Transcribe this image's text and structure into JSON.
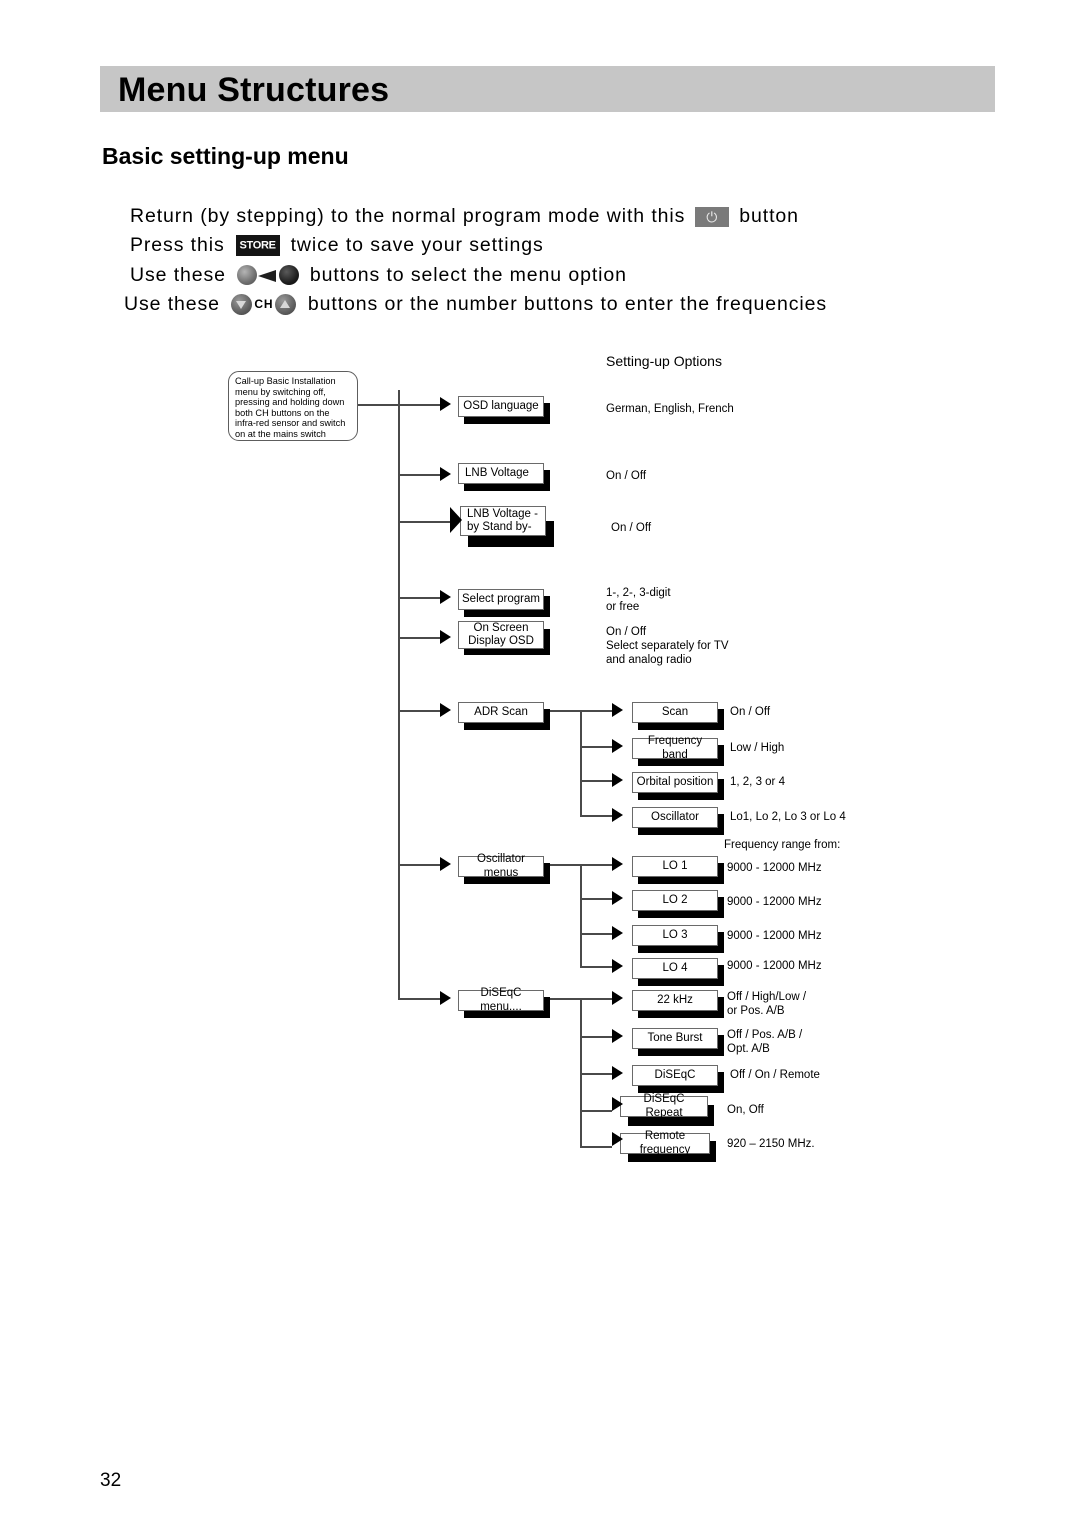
{
  "header": {
    "title": "Menu Structures"
  },
  "section": {
    "title": "Basic setting-up menu"
  },
  "instructions": [
    {
      "before": "Return (by stepping) to the normal program mode with this",
      "icon": "power-button-icon",
      "after": "button"
    },
    {
      "before": "Press this",
      "icon": "store-button-icon",
      "after": "twice to save your settings"
    },
    {
      "before": "Use these",
      "icon": "volume-buttons-icon",
      "after": "buttons to select the menu option"
    },
    {
      "before": "Use these",
      "icon": "channel-buttons-icon",
      "after": "buttons or the number buttons to enter the frequencies"
    }
  ],
  "diagram": {
    "options_header": "Setting-up Options",
    "callout": "Call-up Basic Installation menu by switching off, pressing and holding down both CH buttons on the infra-red sensor and switch on at the mains switch",
    "level1": [
      {
        "label": "OSD language",
        "options": "German, English, French"
      },
      {
        "label": "LNB Voltage",
        "options": "On / Off"
      },
      {
        "label": "LNB Voltage\n-by Stand by-",
        "options": "On / Off"
      },
      {
        "label": "Select program",
        "options": "1-, 2-, 3-digit\nor free"
      },
      {
        "label": "On Screen Display\nOSD",
        "options": "On / Off\nSelect separately for TV\nand analog radio"
      },
      {
        "label": "ADR Scan",
        "options": ""
      },
      {
        "label": "Oscillator menus",
        "options": ""
      },
      {
        "label": "DiSEqC menu....",
        "options": ""
      }
    ],
    "adr_scan_children": [
      {
        "label": "Scan",
        "options": "On / Off"
      },
      {
        "label": "Frequency band",
        "options": "Low / High"
      },
      {
        "label": "Orbital position",
        "options": "1, 2, 3 or 4"
      },
      {
        "label": "Oscillator",
        "options": "Lo1, Lo 2, Lo 3 or Lo 4"
      }
    ],
    "oscillator_children_header": "Frequency range from:",
    "oscillator_children": [
      {
        "label": "LO 1",
        "options": "9000 - 12000  MHz"
      },
      {
        "label": "LO 2",
        "options": "9000 - 12000  MHz"
      },
      {
        "label": "LO 3",
        "options": "9000 - 12000  MHz"
      },
      {
        "label": "LO 4",
        "options": "9000 - 12000  MHz"
      }
    ],
    "diseqc_children": [
      {
        "label": "22 kHz",
        "options": "Off / High/Low /\nor Pos. A/B"
      },
      {
        "label": "Tone Burst",
        "options": "Off / Pos. A/B /\nOpt. A/B"
      },
      {
        "label": "DiSEqC",
        "options": "Off / On / Remote"
      },
      {
        "label": "DiSEqC Repeat",
        "options": "On, Off"
      },
      {
        "label": "Remote frequency",
        "options": "920 – 2150 MHz."
      }
    ]
  },
  "footer": {
    "page_number": "32"
  }
}
